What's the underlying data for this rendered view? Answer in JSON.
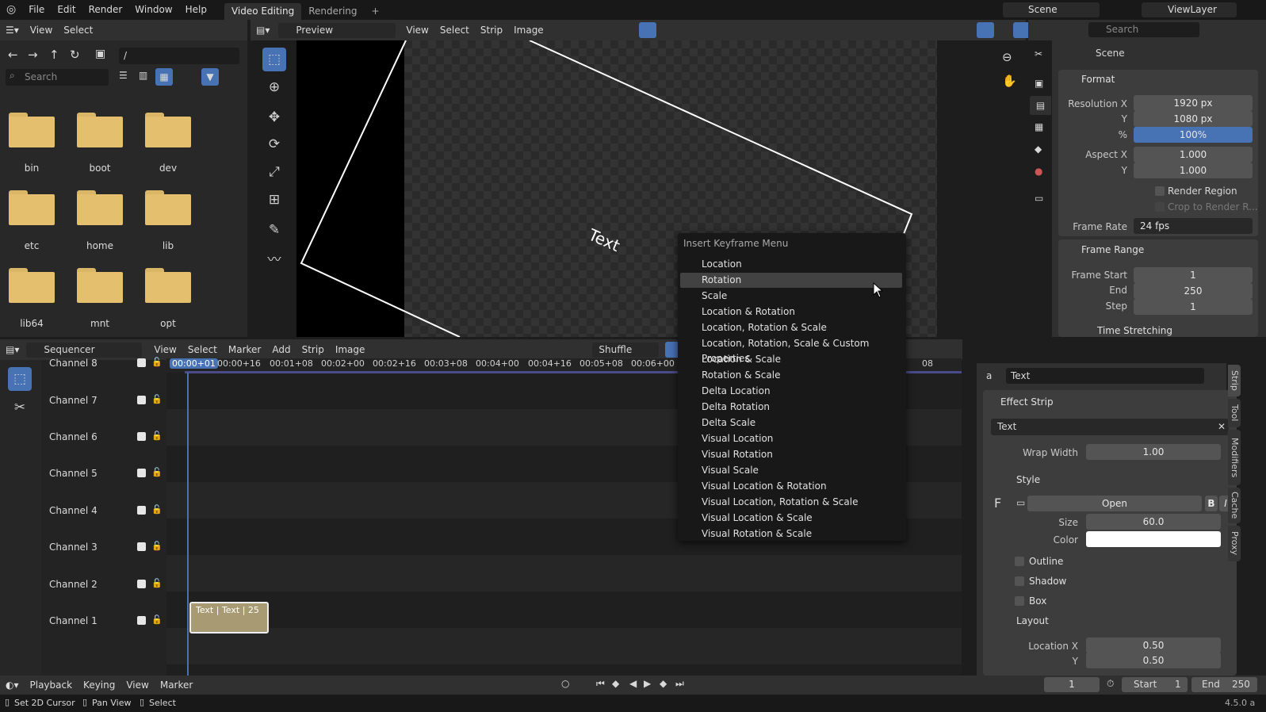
{
  "topbar": {
    "menus": [
      "File",
      "Edit",
      "Render",
      "Window",
      "Help"
    ],
    "tabs": [
      "Video Editing",
      "Rendering"
    ],
    "add_tab": "+",
    "scene": "Scene",
    "view_layer": "ViewLayer"
  },
  "filebrowser": {
    "menus": [
      "View",
      "Select"
    ],
    "path": "/",
    "search_placeholder": "Search",
    "folders": [
      "bin",
      "boot",
      "dev",
      "etc",
      "home",
      "lib",
      "lib64",
      "mnt",
      "opt"
    ]
  },
  "preview": {
    "mode": "Preview",
    "menus": [
      "View",
      "Select",
      "Strip",
      "Image"
    ],
    "canvas_text": "Text"
  },
  "properties": {
    "search_placeholder": "Search",
    "scene_label": "Scene",
    "format_section": "Format",
    "res_x_label": "Resolution X",
    "res_x": "1920 px",
    "res_y_label": "Y",
    "res_y": "1080 px",
    "pct_label": "%",
    "pct": "100%",
    "aspect_x_label": "Aspect X",
    "aspect_x": "1.000",
    "aspect_y_label": "Y",
    "aspect_y": "1.000",
    "render_region": "Render Region",
    "crop": "Crop to Render R...",
    "frame_rate_label": "Frame Rate",
    "frame_rate": "24 fps",
    "frame_range_section": "Frame Range",
    "frame_start_label": "Frame Start",
    "frame_start": "1",
    "end_label": "End",
    "end": "250",
    "step_label": "Step",
    "step": "1",
    "time_stretching": "Time Stretching"
  },
  "menu": {
    "title": "Insert Keyframe Menu",
    "items": [
      "Location",
      "Rotation",
      "Scale",
      "Location & Rotation",
      "Location, Rotation & Scale",
      "Location, Rotation, Scale & Custom Properties",
      "Location & Scale",
      "Rotation & Scale",
      "Delta Location",
      "Delta Rotation",
      "Delta Scale",
      "Visual Location",
      "Visual Rotation",
      "Visual Scale",
      "Visual Location & Rotation",
      "Visual Location, Rotation & Scale",
      "Visual Location & Scale",
      "Visual Rotation & Scale"
    ]
  },
  "sequencer": {
    "editor": "Sequencer",
    "menus": [
      "View",
      "Select",
      "Marker",
      "Add",
      "Strip",
      "Image"
    ],
    "overlap": "Shuffle",
    "channels": [
      "Channel 8",
      "Channel 7",
      "Channel 6",
      "Channel 5",
      "Channel 4",
      "Channel 3",
      "Channel 2",
      "Channel 1"
    ],
    "timecodes": [
      "00:00+01",
      "00:00+16",
      "00:01+08",
      "00:02+00",
      "00:02+16",
      "00:03+08",
      "00:04+00",
      "00:04+16",
      "00:05+08",
      "00:06+00",
      "00",
      "08"
    ],
    "strip_label": "Text | Text | 25"
  },
  "sidebar": {
    "strip_name": "Text",
    "effect_section": "Effect Strip",
    "text_value": "Text",
    "wrap_label": "Wrap Width",
    "wrap": "1.00",
    "style_section": "Style",
    "font_open": "Open",
    "size_label": "Size",
    "size": "60.0",
    "color_label": "Color",
    "outline": "Outline",
    "shadow": "Shadow",
    "box": "Box",
    "layout_section": "Layout",
    "loc_x_label": "Location X",
    "loc_x": "0.50",
    "loc_y_label": "Y",
    "loc_y": "0.50",
    "tabs": [
      "Strip",
      "Tool",
      "Modifiers",
      "Cache",
      "Proxy"
    ]
  },
  "timeline": {
    "menus": [
      "Playback",
      "Keying",
      "View",
      "Marker"
    ],
    "current": "1",
    "start_label": "Start",
    "start": "1",
    "end_label": "End",
    "end": "250"
  },
  "status": {
    "items": [
      "Set 2D Cursor",
      "Pan View",
      "Select"
    ],
    "version": "4.5.0 a"
  }
}
